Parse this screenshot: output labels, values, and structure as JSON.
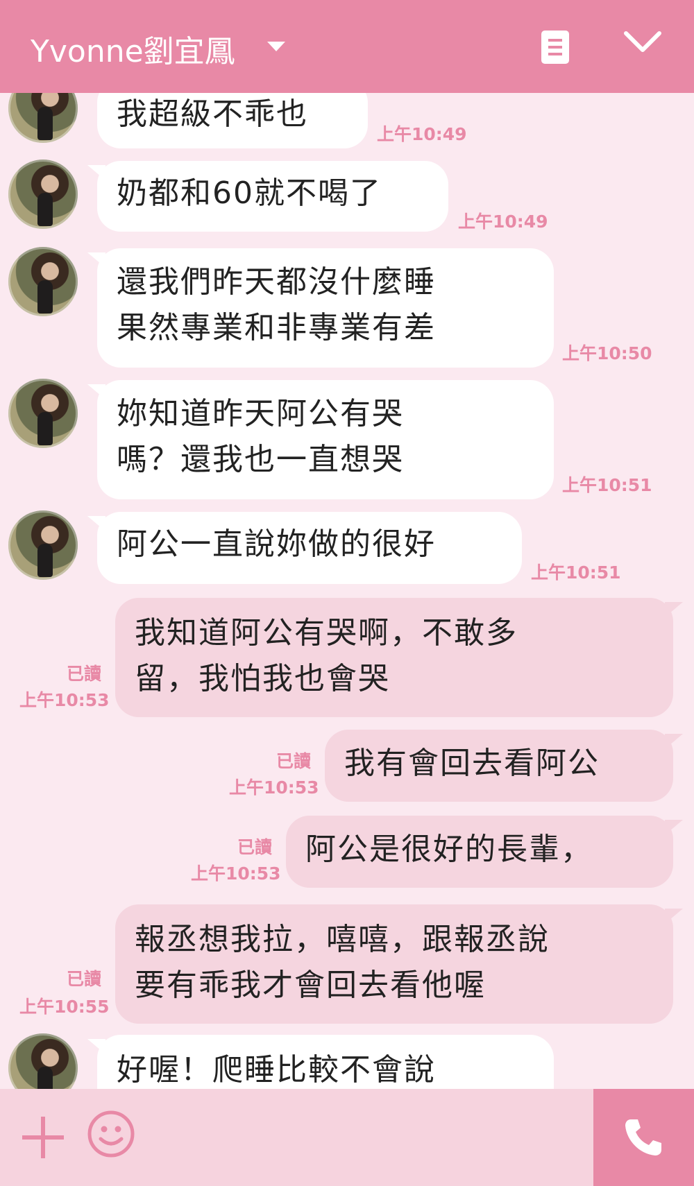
{
  "header": {
    "title": "Yvonne劉宜鳳"
  },
  "messages": [
    {
      "side": "in",
      "lines": [
        "我超級不乖也"
      ],
      "time": "上午10:49"
    },
    {
      "side": "in",
      "lines": [
        "奶都和60就不喝了"
      ],
      "time": "上午10:49"
    },
    {
      "side": "in",
      "lines": [
        "還我們昨天都沒什麼睡",
        "果然專業和非專業有差"
      ],
      "time": "上午10:50"
    },
    {
      "side": "in",
      "lines": [
        "妳知道昨天阿公有哭",
        "嗎？還我也一直想哭"
      ],
      "time": "上午10:51"
    },
    {
      "side": "in",
      "lines": [
        "阿公一直說妳做的很好"
      ],
      "time": "上午10:51"
    },
    {
      "side": "out",
      "lines": [
        "我知道阿公有哭啊，不敢多",
        "留，我怕我也會哭"
      ],
      "read": "已讀",
      "time": "上午10:53"
    },
    {
      "side": "out",
      "lines": [
        "我有會回去看阿公"
      ],
      "read": "已讀",
      "time": "上午10:53"
    },
    {
      "side": "out",
      "lines": [
        "阿公是很好的長輩，"
      ],
      "read": "已讀",
      "time": "上午10:53"
    },
    {
      "side": "out",
      "lines": [
        "報丞想我拉，嘻嘻，跟報丞說",
        "要有乖我才會回去看他喔"
      ],
      "read": "已讀",
      "time": "上午10:55"
    },
    {
      "side": "in",
      "lines": [
        "好喔！爬睡比較不會說"
      ],
      "time": ""
    }
  ],
  "colors": {
    "accent": "#e889a6",
    "background": "#fbe9f0",
    "outgoing_bubble": "#f5d5df",
    "incoming_bubble": "#ffffff"
  },
  "icons": [
    "dropdown-caret-icon",
    "menu-icon",
    "chevron-down-icon",
    "plus-icon",
    "smile-icon",
    "phone-icon"
  ]
}
